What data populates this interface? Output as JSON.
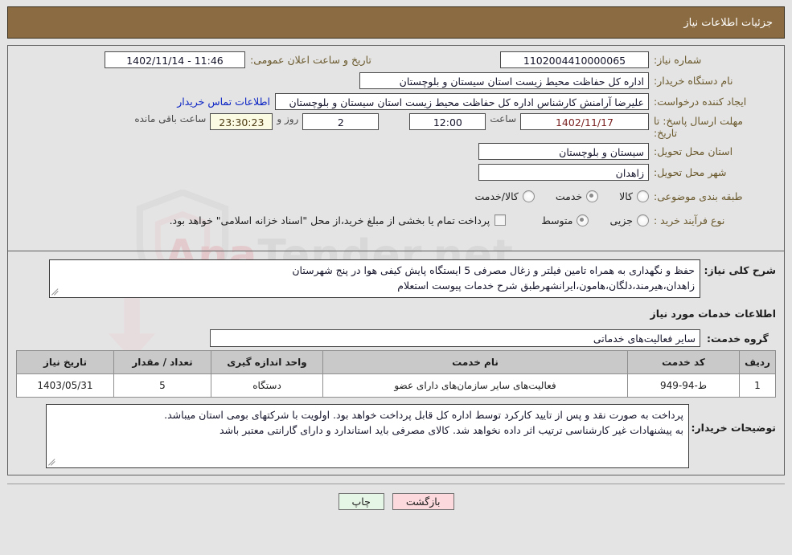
{
  "header": {
    "title": "جزئیات اطلاعات نیاز"
  },
  "fields": {
    "need_number_label": "شماره نیاز:",
    "need_number_value": "1102004410000065",
    "public_announce_label": "تاریخ و ساعت اعلان عمومی:",
    "public_announce_value": "11:46 - 1402/11/14",
    "buyer_agency_label": "نام دستگاه خریدار:",
    "buyer_agency_value": "اداره کل حفاظت محیط زیست استان سیستان و بلوچستان",
    "creator_label": "ایجاد کننده درخواست:",
    "creator_value": "علیرضا آرامنش کارشناس اداره کل حفاظت محیط زیست استان سیستان و بلوچستان",
    "buyer_contact_link": "اطلاعات تماس خریدار",
    "deadline_label_line1": "مهلت ارسال پاسخ: تا",
    "deadline_label_line2": "تاریخ:",
    "deadline_date": "1402/11/17",
    "hour_word": "ساعت",
    "deadline_time": "12:00",
    "days_value": "2",
    "days_word": "روز و",
    "countdown_value": "23:30:23",
    "remaining_word": "ساعت باقی مانده",
    "province_label": "استان محل تحویل:",
    "province_value": "سیستان و بلوچستان",
    "city_label": "شهر محل تحویل:",
    "city_value": "زاهدان",
    "category_label": "طبقه بندی موضوعی:",
    "purchase_type_label": "نوع فرآیند خرید :",
    "treasury_note": "پرداخت تمام یا بخشی از مبلغ خرید،از محل \"اسناد خزانه اسلامی\" خواهد بود."
  },
  "category_options": [
    {
      "label": "کالا",
      "selected": false
    },
    {
      "label": "خدمت",
      "selected": true
    },
    {
      "label": "کالا/خدمت",
      "selected": false
    }
  ],
  "purchase_options": [
    {
      "label": "جزیی",
      "selected": false
    },
    {
      "label": "متوسط",
      "selected": true
    }
  ],
  "description": {
    "label": "شرح کلی نیاز:",
    "line1": "حفظ و نگهداری به همراه تامین فیلتر و زغال مصرفی 5 ایستگاه پایش کیفی هوا در پنج شهرستان",
    "line2": "زاهدان،هیرمند،دلگان،هامون،ایرانشهرطبق شرح خدمات پیوست استعلام"
  },
  "services_section": {
    "title": "اطلاعات خدمات مورد نیاز",
    "service_group_label": "گروه خدمت:",
    "service_group_value": "سایر فعالیت‌های خدماتی"
  },
  "table": {
    "headers": [
      "ردیف",
      "کد خدمت",
      "نام خدمت",
      "واحد اندازه گیری",
      "تعداد / مقدار",
      "تاریخ نیاز"
    ],
    "rows": [
      {
        "row": "1",
        "code": "ط-94-949",
        "name": "فعالیت‌های سایر سازمان‌های دارای عضو",
        "unit": "دستگاه",
        "qty": "5",
        "date": "1403/05/31"
      }
    ]
  },
  "buyer_notes": {
    "label": "توضیحات خریدار:",
    "line1": "پرداخت به صورت نقد و پس از تایید کارکرد توسط اداره کل قابل پرداخت خواهد بود. اولویت با شرکتهای بومی استان میباشد.",
    "line2": "به پیشنهادات غیر کارشناسی ترتیب اثر داده نخواهد شد. کالای مصرفی باید استاندارد و دارای گارانتی معتبر باشد"
  },
  "buttons": {
    "print": "چاپ",
    "back": "بازگشت"
  },
  "watermark": {
    "text_left": "Ana",
    "text_right": "Tender",
    "text_suffix": ".net"
  },
  "colors": {
    "header_band": "#8b6c42",
    "label_brown": "#6b5a2e",
    "link_blue": "#0b24c4",
    "date_maroon": "#7a1f1f",
    "print_button": "#e6f6e6",
    "back_button": "#fbd9dd",
    "table_header": "#c9c9c9"
  }
}
